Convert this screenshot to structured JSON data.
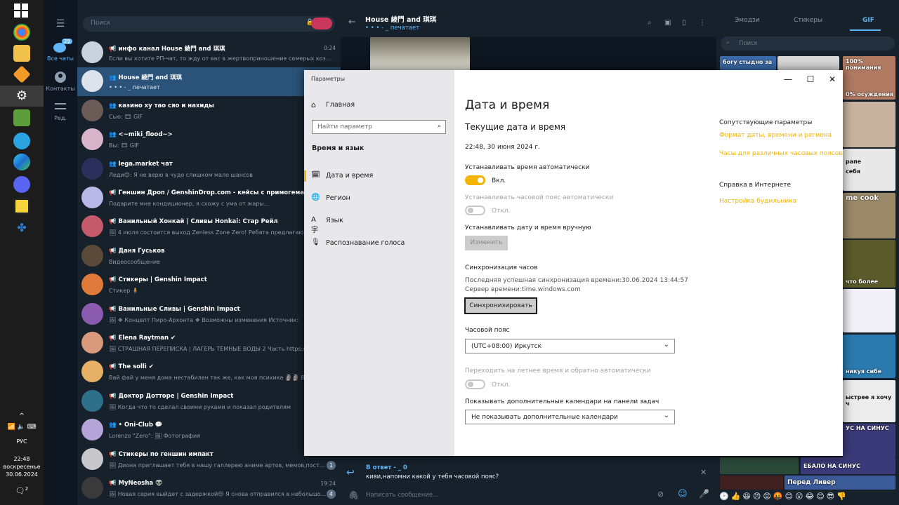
{
  "taskbar": {
    "language": "РУС",
    "time": "22:48",
    "weekday": "воскресенье",
    "date": "30.06.2024",
    "notif_count": "2",
    "icons": [
      "windows-start-icon",
      "chrome-icon",
      "file-explorer-icon",
      "sublime-icon",
      "settings-icon",
      "minecraft-icon",
      "telegram-icon",
      "edge-icon",
      "discord-icon",
      "app-icon",
      "network-icon"
    ]
  },
  "tgnav": {
    "all_chats": "Все чаты",
    "all_chats_badge": "29",
    "contacts": "Контакты",
    "edit": "Ред."
  },
  "chatlist": {
    "search_placeholder": "Поиск",
    "chats": [
      {
        "name": "📢 инфо канал Hоuse 綾門 аnd 琪琪",
        "msg": "Если вы хотите РП-чат, то жду от вас в жертвоприношение семерых коз...",
        "time": "0:24",
        "badge": "",
        "color": "#c9d2dc"
      },
      {
        "name": "👥 Hоuse 綾門 аnd 琪琪",
        "msg": "• • • - _ печатает",
        "time": "",
        "badge": "",
        "color": "#dde3ea"
      },
      {
        "name": "👥 казино ху тао сяо и нахиды",
        "msg": "Сью: 🎞 GIF",
        "time": "",
        "badge": "",
        "color": "#6b5c58"
      },
      {
        "name": "👥 <~miki_flood~>",
        "msg": "Вы: 🎞 GIF",
        "time": "",
        "badge": "",
        "color": "#d8b4c8"
      },
      {
        "name": "👥 lega.market чат",
        "msg": "Леди😊: Я не верю в чудо слишком мало шансов",
        "time": "",
        "badge": "",
        "color": "#2a2f5c"
      },
      {
        "name": "📢 Геншин Дроп / GenshinDrop.com - кейсы с примогемами Генш",
        "msg": "Подарите мне кондиционер, я схожу с ума от жары...",
        "time": "",
        "badge": "",
        "color": "#b9b7e6"
      },
      {
        "name": "📢 Ванильный Хонкай | Сливы Honkai: Стар Рейл",
        "msg": "🖼 4 июля состоится выход Zenless Zone Zero! Ребята предлагают",
        "time": "",
        "badge": "",
        "color": "#c45a6a"
      },
      {
        "name": "📢 Даня Гуськов",
        "msg": "Видеосообщение",
        "time": "",
        "badge": "",
        "color": "#5b4a3a"
      },
      {
        "name": "📢 Стикеры | Genshin Impact",
        "msg": "Стикер 🧍",
        "time": "",
        "badge": "",
        "color": "#e07a3a"
      },
      {
        "name": "📢 Ванильные Сливы | Genshin Impact",
        "msg": "🖼 ❖ Концепт Пиро-Архонта ❖ Возможны изменения   Источник:",
        "time": "",
        "badge": "",
        "color": "#8a5ab0"
      },
      {
        "name": "📢 Elena Raytman ✔",
        "msg": "🖼 СТРАШНАЯ ПЕРЕПИСКА | ЛАГЕРЬ ТЁМНЫЕ ВОДЫ 2 Часть https:/",
        "time": "",
        "badge": "",
        "color": "#d89a7a"
      },
      {
        "name": "📢 The solli ✔",
        "msg": "Вай фай у меня дома нестабилен так же, как моя психика 🗿🗿 В",
        "time": "",
        "badge": "",
        "color": "#e6b066"
      },
      {
        "name": "📢 Доктор Доттоpe | Genshin Impact",
        "msg": "🖼 Когда что то сделал своими руками и показал родителям",
        "time": "",
        "badge": "",
        "color": "#2e6f8a"
      },
      {
        "name": "👥 • Oni-Club 💬",
        "msg": "Lorenzo \"Zero\": 🖼 Фотография",
        "time": "",
        "badge": "",
        "color": "#b4a4d8"
      },
      {
        "name": "📢 Стикеры по геншин импакт",
        "msg": "🖼 Диона приглашает тебя в нашу галлерею аниме артов, мемов,пост...",
        "time": "",
        "badge": "1",
        "color": "#c8c8cc"
      },
      {
        "name": "📢 MyNeosha 👽",
        "msg": "🖼 Новая серия выйдет с задержкой😔 Я снова отправился в небольшо...",
        "time": "19:24",
        "badge": "4",
        "color": "#3a3a3a"
      }
    ]
  },
  "conv": {
    "title": "Hоuse 綾門 аnd 琪琪",
    "status": "• • • - _ печатает",
    "reply_to": "В ответ - _ 0",
    "reply_text": "киви,напомни какой у тебя часовой пояс?",
    "input_placeholder": "Написать сообщение..."
  },
  "gifpanel": {
    "tabs": [
      "Эмодзи",
      "Стикеры",
      "GIF"
    ],
    "active_tab": "GIF",
    "search_placeholder": "Поиск",
    "captions": [
      "богу стыдно за",
      "100% понимания",
      "0% осуждения",
      "рапе",
      "себя",
      "me cook",
      "что более",
      "никуя сибе",
      "ыстрее я хочу ч",
      "УС НА СИНУС",
      "ЕБАЛО НА СИНУС",
      "Перед Ливер"
    ]
  },
  "settings": {
    "window_title": "Параметры",
    "home": "Главная",
    "search_placeholder": "Найти параметр",
    "section": "Время и язык",
    "nav": [
      "Дата и время",
      "Регион",
      "Язык",
      "Распознавание голоса"
    ],
    "active_nav": "Дата и время",
    "page_title": "Дата и время",
    "current_heading": "Текущие дата и время",
    "current_value": "22:48, 30 июня 2024 г.",
    "auto_time_label": "Устанавливать время автоматически",
    "auto_time_state": "Вкл.",
    "auto_tz_label": "Устанавливать часовой пояс автоматически",
    "auto_tz_state": "Откл.",
    "manual_label": "Устанавливать дату и время вручную",
    "manual_button": "Изменить",
    "sync_heading": "Синхронизация часов",
    "sync_last": "Последняя успешная синхронизация времени:30.06.2024 13:44:57",
    "sync_server": "Сервер времени:time.windows.com",
    "sync_button": "Синхронизировать",
    "tz_label": "Часовой пояс",
    "tz_value": "(UTC+08:00) Иркутск",
    "dst_label": "Переходить на летнее время и обратно автоматически",
    "dst_state": "Откл.",
    "calendars_label": "Показывать дополнительные календари на панели задач",
    "calendars_value": "Не показывать дополнительные календари",
    "related_heading": "Сопутствующие параметры",
    "related_link1": "Формат даты, времени и региона",
    "related_link2": "Часы для различных часовых поясов",
    "help_heading": "Справка в Интернете",
    "help_link1": "Настройка будильника"
  }
}
